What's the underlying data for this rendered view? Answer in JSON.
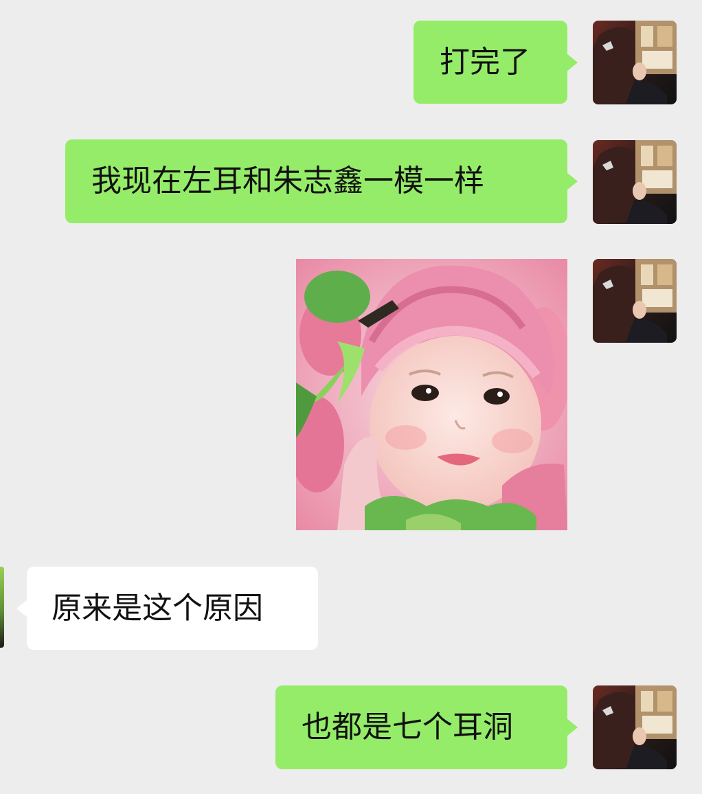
{
  "messages": [
    {
      "direction": "out",
      "type": "text",
      "text": "打完了"
    },
    {
      "direction": "out",
      "type": "text",
      "text": "我现在左耳和朱志鑫一模一样"
    },
    {
      "direction": "out",
      "type": "image",
      "image_description": "baby-in-pink-flower-hat-sticker"
    },
    {
      "direction": "in",
      "type": "text",
      "text": "原来是这个原因"
    },
    {
      "direction": "out",
      "type": "text",
      "text": "也都是七个耳洞"
    }
  ],
  "colors": {
    "background": "#ededed",
    "outgoing_bubble": "#95ec69",
    "incoming_bubble": "#ffffff",
    "text": "#111111"
  }
}
